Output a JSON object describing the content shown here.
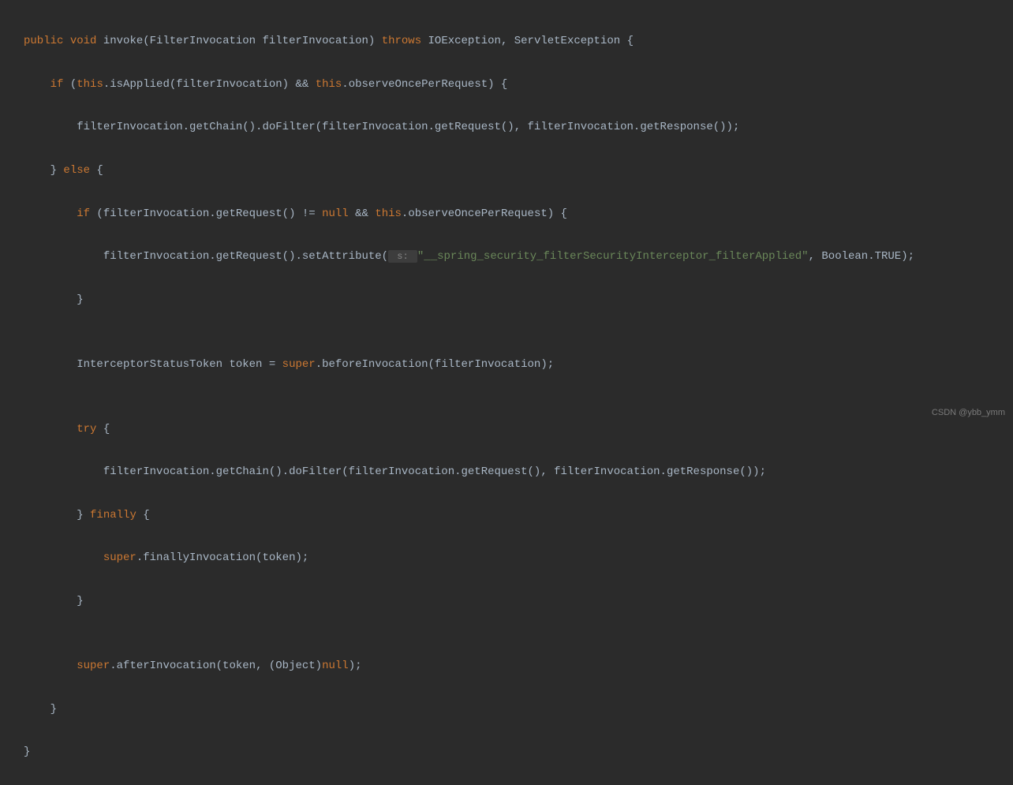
{
  "code": {
    "l1_kw1": "public",
    "l1_kw2": "void",
    "l1_rest": " invoke(FilterInvocation filterInvocation) ",
    "l1_kw3": "throws",
    "l1_rest2": " IOException, ServletException {",
    "l2_kw1": "if",
    "l2_p1": " (",
    "l2_kw2": "this",
    "l2_p2": ".isApplied(filterInvocation) && ",
    "l2_kw3": "this",
    "l2_p3": ".observeOncePerRequest) {",
    "l3": "filterInvocation.getChain().doFilter(filterInvocation.getRequest(), filterInvocation.getResponse());",
    "l4_p1": "} ",
    "l4_kw1": "else",
    "l4_p2": " {",
    "l5_kw1": "if",
    "l5_p1": " (filterInvocation.getRequest() != ",
    "l5_kw2": "null",
    "l5_p2": " && ",
    "l5_kw3": "this",
    "l5_p3": ".observeOncePerRequest) {",
    "l6_p1": "filterInvocation.getRequest().setAttribute(",
    "l6_hint": " s: ",
    "l6_str": "\"__spring_security_filterSecurityInterceptor_filterApplied\"",
    "l6_p2": ", Boolean.TRUE);",
    "l7": "}",
    "l8_p1": "InterceptorStatusToken token = ",
    "l8_kw1": "super",
    "l8_p2": ".beforeInvocation(filterInvocation);",
    "l9_kw1": "try",
    "l9_p1": " {",
    "l10": "filterInvocation.getChain().doFilter(filterInvocation.getRequest(), filterInvocation.getResponse());",
    "l11_p1": "} ",
    "l11_kw1": "finally",
    "l11_p2": " {",
    "l12_kw1": "super",
    "l12_p1": ".finallyInvocation(token);",
    "l13": "}",
    "l14_kw1": "super",
    "l14_p1": ".afterInvocation(token, (Object)",
    "l14_kw2": "null",
    "l14_p2": ");",
    "l15": "}",
    "l16": "}"
  },
  "watermark": "CSDN @ybb_ymm"
}
